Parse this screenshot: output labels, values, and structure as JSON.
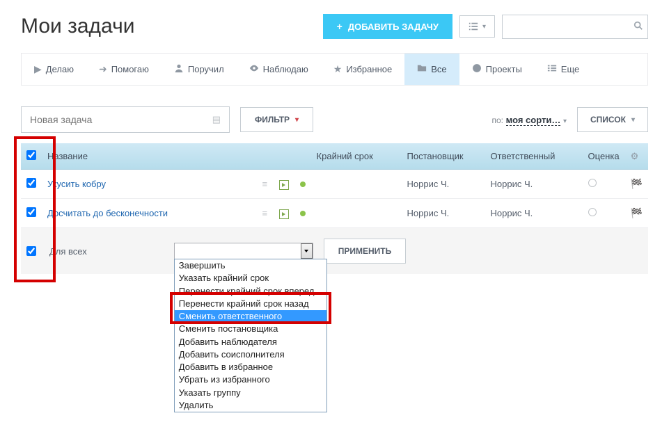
{
  "title": "Мои задачи",
  "add_button": "ДОБАВИТЬ ЗАДАЧУ",
  "search_placeholder": "",
  "tabs": [
    {
      "label": "Делаю"
    },
    {
      "label": "Помогаю"
    },
    {
      "label": "Поручил"
    },
    {
      "label": "Наблюдаю"
    },
    {
      "label": "Избранное"
    },
    {
      "label": "Все"
    },
    {
      "label": "Проекты"
    },
    {
      "label": "Еще"
    }
  ],
  "new_task_placeholder": "Новая задача",
  "filter_btn": "ФИЛЬТР",
  "sort_prefix": "по:",
  "sort_value": "моя сорти…",
  "list_btn": "СПИСОК",
  "columns": {
    "name": "Название",
    "deadline": "Крайний срок",
    "creator": "Постановщик",
    "assignee": "Ответственный",
    "rating": "Оценка"
  },
  "rows": [
    {
      "title": "Укусить кобру",
      "creator": "Норрис Ч.",
      "assignee": "Норрис Ч."
    },
    {
      "title": "Досчитать до бесконечности",
      "creator": "Норрис Ч.",
      "assignee": "Норрис Ч."
    }
  ],
  "bulk": {
    "for_all": "Для всех",
    "apply": "ПРИМЕНИТЬ",
    "options": [
      "Завершить",
      "Указать крайний срок",
      "Перенести крайний срок вперед",
      "Перенести крайний срок назад",
      "Сменить ответственного",
      "Сменить постановщика",
      "Добавить наблюдателя",
      "Добавить соисполнителя",
      "Добавить в избранное",
      "Убрать из избранного",
      "Указать группу",
      "Удалить"
    ],
    "selected_index": 4
  }
}
